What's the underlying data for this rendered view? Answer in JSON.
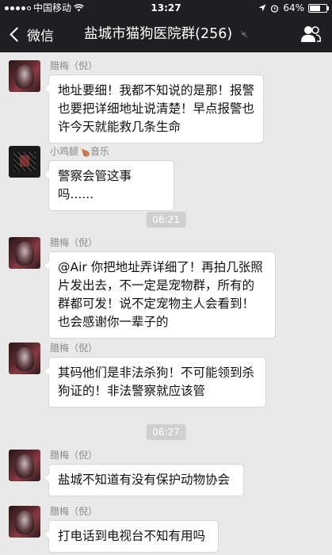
{
  "status_bar": {
    "carrier": "中国移动",
    "time": "13:27",
    "battery": "64%",
    "battery_level": 0.64
  },
  "nav": {
    "back_label": "微信",
    "title": "盐城市猫狗医院群(256)"
  },
  "messages": [
    {
      "sender": "腊梅（倪）",
      "lines": [
        "地址要细！我都不知说的是那！报警",
        "也要把详细地址说清楚！早点报警也",
        "许今天就能救几条生命"
      ]
    },
    {
      "sender": "小鸡腿🍗音乐",
      "lines": [
        "警察会管这事吗......"
      ]
    },
    {
      "sender": "腊梅（倪）",
      "lines": [
        "@Air 你把地址弄详细了！再拍几张照",
        "片发出去，不一定是宠物群，所有的",
        "群都可发！说不定宠物主人会看到！",
        "也会感谢你一辈子的"
      ]
    },
    {
      "sender": "腊梅（倪）",
      "lines": [
        "其码他们是非法杀狗！不可能领到杀",
        "狗证的！非法警察就应该管"
      ]
    },
    {
      "sender": "腊梅（倪）",
      "lines": [
        "盐城不知道有没有保护动物协会"
      ]
    },
    {
      "sender": "腊梅（倪）",
      "lines": [
        "打电话到电视台不知有用吗"
      ]
    }
  ],
  "timestamps": [
    "06:21",
    "06:27"
  ]
}
